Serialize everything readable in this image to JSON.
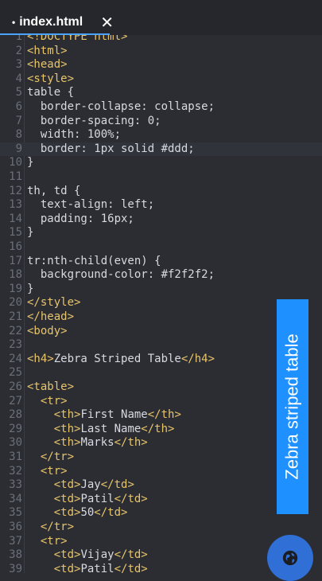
{
  "tab": {
    "dot": "•",
    "title": "index.html",
    "close": "✕"
  },
  "banner": {
    "text": "Zebra striped table"
  },
  "fab": {
    "icon": "globe-icon"
  },
  "colors": {
    "accent": "#1e90ff",
    "tag": "#e8c46a",
    "text": "#d7dae0",
    "line_numbers": "#6b6f7a",
    "background": "#2b2d33"
  },
  "current_line": 9,
  "lines": [
    {
      "n": "1",
      "parts": [
        [
          "t",
          "<!DOCTYPE html>"
        ]
      ]
    },
    {
      "n": "2",
      "parts": [
        [
          "t",
          "<html>"
        ]
      ]
    },
    {
      "n": "3",
      "parts": [
        [
          "t",
          "<head>"
        ]
      ]
    },
    {
      "n": "4",
      "parts": [
        [
          "t",
          "<style>"
        ]
      ]
    },
    {
      "n": "5",
      "parts": [
        [
          "p",
          "table {"
        ]
      ]
    },
    {
      "n": "6",
      "parts": [
        [
          "p",
          "  border-collapse: collapse;"
        ]
      ]
    },
    {
      "n": "7",
      "parts": [
        [
          "p",
          "  border-spacing: 0;"
        ]
      ]
    },
    {
      "n": "8",
      "parts": [
        [
          "p",
          "  width: 100%;"
        ]
      ]
    },
    {
      "n": "9",
      "parts": [
        [
          "p",
          "  border: 1px solid #ddd;"
        ]
      ]
    },
    {
      "n": "10",
      "parts": [
        [
          "p",
          "}"
        ]
      ]
    },
    {
      "n": "11",
      "parts": []
    },
    {
      "n": "12",
      "parts": [
        [
          "p",
          "th, td {"
        ]
      ]
    },
    {
      "n": "13",
      "parts": [
        [
          "p",
          "  text-align: left;"
        ]
      ]
    },
    {
      "n": "14",
      "parts": [
        [
          "p",
          "  padding: 16px;"
        ]
      ]
    },
    {
      "n": "15",
      "parts": [
        [
          "p",
          "}"
        ]
      ]
    },
    {
      "n": "16",
      "parts": []
    },
    {
      "n": "17",
      "parts": [
        [
          "p",
          "tr:nth-child(even) {"
        ]
      ]
    },
    {
      "n": "18",
      "parts": [
        [
          "p",
          "  background-color: #f2f2f2;"
        ]
      ]
    },
    {
      "n": "19",
      "parts": [
        [
          "p",
          "}"
        ]
      ]
    },
    {
      "n": "20",
      "parts": [
        [
          "t",
          "</style>"
        ]
      ]
    },
    {
      "n": "21",
      "parts": [
        [
          "t",
          "</head>"
        ]
      ]
    },
    {
      "n": "22",
      "parts": [
        [
          "t",
          "<body>"
        ]
      ]
    },
    {
      "n": "23",
      "parts": []
    },
    {
      "n": "24",
      "parts": [
        [
          "t",
          "<h4>"
        ],
        [
          "p",
          "Zebra Striped Table"
        ],
        [
          "t",
          "</h4>"
        ]
      ]
    },
    {
      "n": "25",
      "parts": []
    },
    {
      "n": "26",
      "parts": [
        [
          "t",
          "<table>"
        ]
      ]
    },
    {
      "n": "27",
      "parts": [
        [
          "p",
          "  "
        ],
        [
          "t",
          "<tr>"
        ]
      ]
    },
    {
      "n": "28",
      "parts": [
        [
          "p",
          "    "
        ],
        [
          "t",
          "<th>"
        ],
        [
          "p",
          "First Name"
        ],
        [
          "t",
          "</th>"
        ]
      ]
    },
    {
      "n": "29",
      "parts": [
        [
          "p",
          "    "
        ],
        [
          "t",
          "<th>"
        ],
        [
          "p",
          "Last Name"
        ],
        [
          "t",
          "</th>"
        ]
      ]
    },
    {
      "n": "30",
      "parts": [
        [
          "p",
          "    "
        ],
        [
          "t",
          "<th>"
        ],
        [
          "p",
          "Marks"
        ],
        [
          "t",
          "</th>"
        ]
      ]
    },
    {
      "n": "31",
      "parts": [
        [
          "p",
          "  "
        ],
        [
          "t",
          "</tr>"
        ]
      ]
    },
    {
      "n": "32",
      "parts": [
        [
          "p",
          "  "
        ],
        [
          "t",
          "<tr>"
        ]
      ]
    },
    {
      "n": "33",
      "parts": [
        [
          "p",
          "    "
        ],
        [
          "t",
          "<td>"
        ],
        [
          "p",
          "Jay"
        ],
        [
          "t",
          "</td>"
        ]
      ]
    },
    {
      "n": "34",
      "parts": [
        [
          "p",
          "    "
        ],
        [
          "t",
          "<td>"
        ],
        [
          "p",
          "Patil"
        ],
        [
          "t",
          "</td>"
        ]
      ]
    },
    {
      "n": "35",
      "parts": [
        [
          "p",
          "    "
        ],
        [
          "t",
          "<td>"
        ],
        [
          "p",
          "50"
        ],
        [
          "t",
          "</td>"
        ]
      ]
    },
    {
      "n": "36",
      "parts": [
        [
          "p",
          "  "
        ],
        [
          "t",
          "</tr>"
        ]
      ]
    },
    {
      "n": "37",
      "parts": [
        [
          "p",
          "  "
        ],
        [
          "t",
          "<tr>"
        ]
      ]
    },
    {
      "n": "38",
      "parts": [
        [
          "p",
          "    "
        ],
        [
          "t",
          "<td>"
        ],
        [
          "p",
          "Vijay"
        ],
        [
          "t",
          "</td>"
        ]
      ]
    },
    {
      "n": "39",
      "parts": [
        [
          "p",
          "    "
        ],
        [
          "t",
          "<td>"
        ],
        [
          "p",
          "Patil"
        ],
        [
          "t",
          "</td>"
        ]
      ]
    }
  ]
}
